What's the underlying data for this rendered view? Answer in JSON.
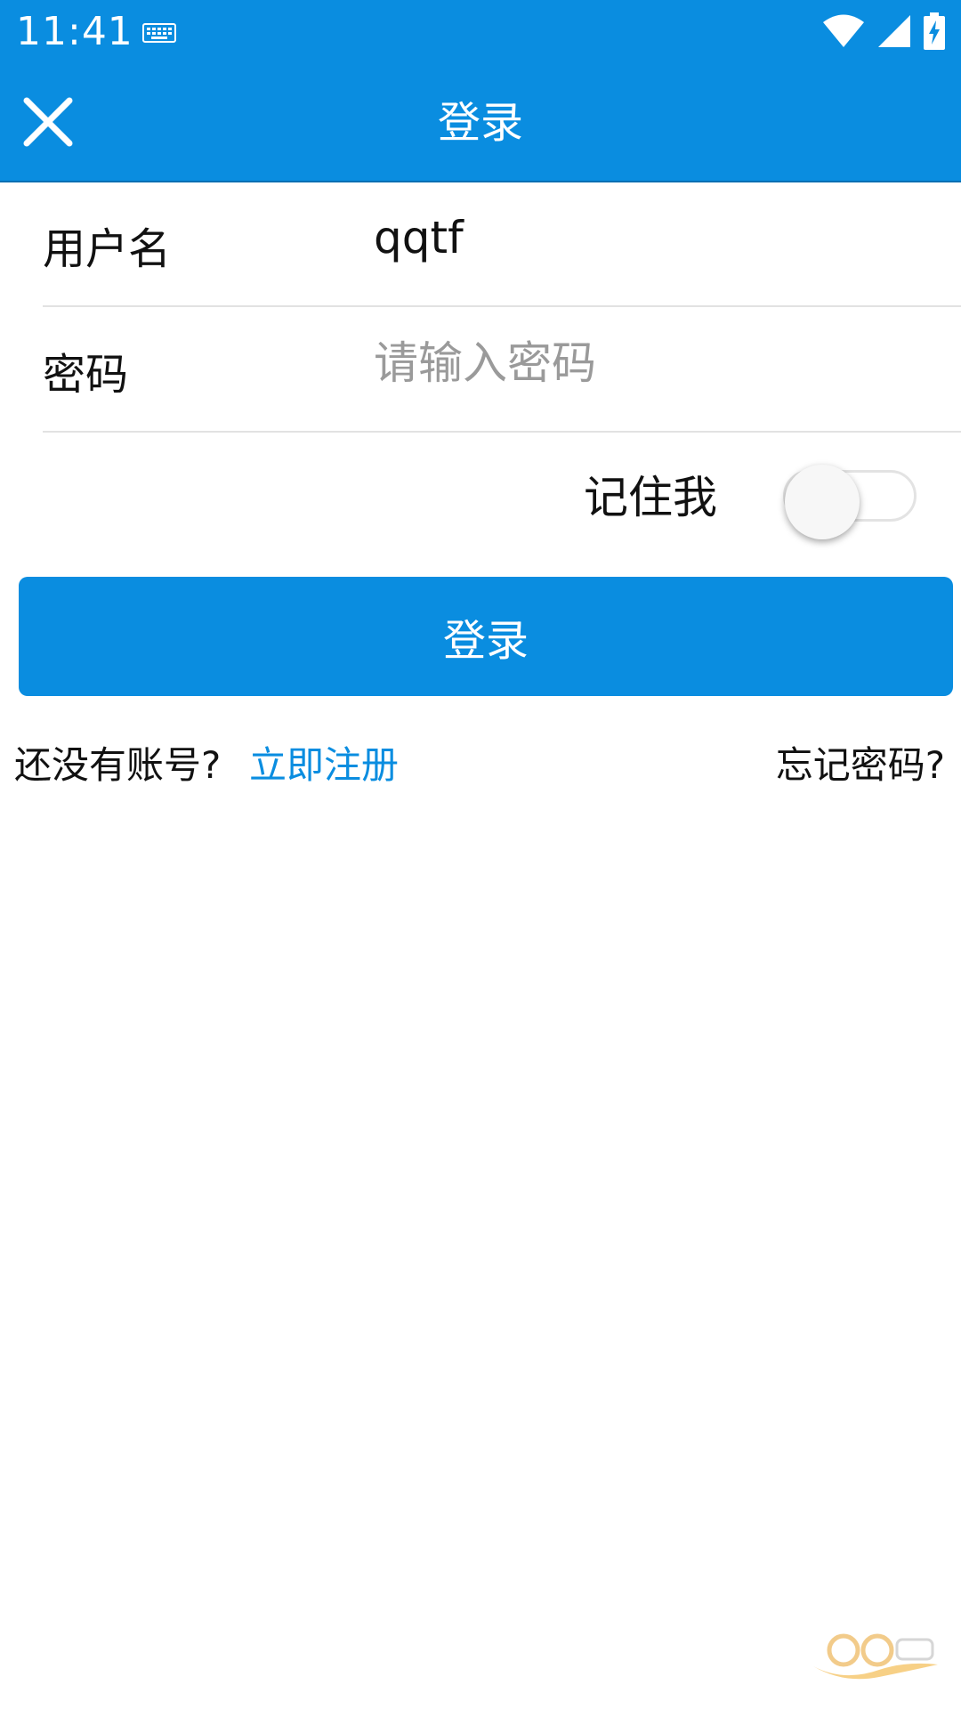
{
  "status_bar": {
    "time": "11:41",
    "icons": [
      "keyboard-icon",
      "wifi-icon",
      "signal-icon",
      "battery-charging-icon"
    ]
  },
  "app_bar": {
    "title": "登录",
    "close_icon": "close-icon"
  },
  "form": {
    "username": {
      "label": "用户名",
      "value": "qqtf",
      "placeholder": ""
    },
    "password": {
      "label": "密码",
      "value": "",
      "placeholder": "请输入密码"
    },
    "remember": {
      "label": "记住我",
      "checked": false
    },
    "submit_label": "登录"
  },
  "footer": {
    "no_account_text": "还没有账号?",
    "register_label": "立即注册",
    "forgot_label": "忘记密码?"
  },
  "colors": {
    "primary": "#0a8de0",
    "text": "#111111",
    "placeholder": "#9a9a9a",
    "divider": "#e2e2e2"
  }
}
